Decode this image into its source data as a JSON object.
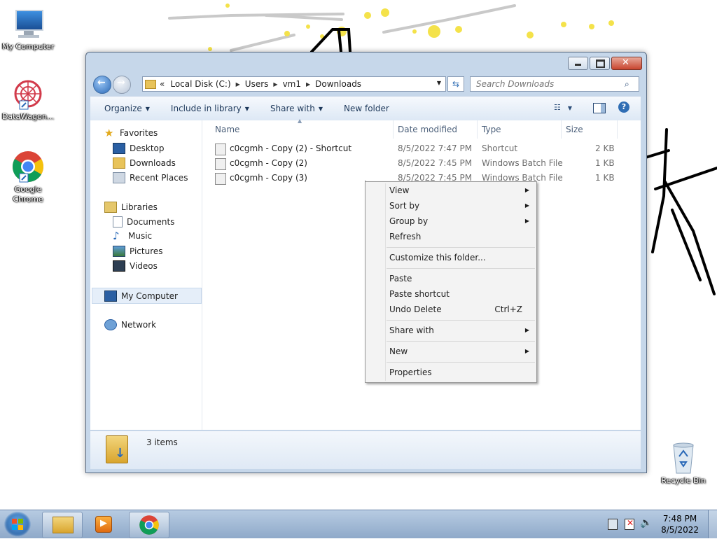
{
  "desktop": {
    "icons": [
      {
        "label": "My Computer"
      },
      {
        "label": "DataWagon..."
      },
      {
        "label": "Google Chrome"
      },
      {
        "label": "Recycle Bin"
      }
    ]
  },
  "window": {
    "address": {
      "overflow": "«",
      "crumbs": [
        "Local Disk (C:)",
        "Users",
        "vm1",
        "Downloads"
      ]
    },
    "search": {
      "placeholder": "Search Downloads"
    },
    "toolbar": {
      "organize": "Organize",
      "include": "Include in library",
      "share": "Share with",
      "new_folder": "New folder"
    },
    "nav": {
      "favorites": "Favorites",
      "desktop": "Desktop",
      "downloads": "Downloads",
      "recent": "Recent Places",
      "libraries": "Libraries",
      "documents": "Documents",
      "music": "Music",
      "pictures": "Pictures",
      "videos": "Videos",
      "computer": "My Computer",
      "network": "Network"
    },
    "columns": {
      "name": "Name",
      "date": "Date modified",
      "type": "Type",
      "size": "Size"
    },
    "files": [
      {
        "name": "c0cgmh - Copy (2) - Shortcut",
        "date": "8/5/2022 7:47 PM",
        "type": "Shortcut",
        "size": "2 KB"
      },
      {
        "name": "c0cgmh - Copy (2)",
        "date": "8/5/2022 7:45 PM",
        "type": "Windows Batch File",
        "size": "1 KB"
      },
      {
        "name": "c0cgmh - Copy (3)",
        "date": "8/5/2022 7:45 PM",
        "type": "Windows Batch File",
        "size": "1 KB"
      }
    ],
    "status": {
      "count": "3 items"
    }
  },
  "context_menu": {
    "view": "View",
    "sort_by": "Sort by",
    "group_by": "Group by",
    "refresh": "Refresh",
    "customize": "Customize this folder...",
    "paste": "Paste",
    "paste_shortcut": "Paste shortcut",
    "undo_delete": "Undo Delete",
    "undo_shortcut": "Ctrl+Z",
    "share_with": "Share with",
    "new": "New",
    "properties": "Properties"
  },
  "taskbar": {
    "time": "7:48 PM",
    "date": "8/5/2022"
  },
  "colors": {
    "accent": "#2a69b8",
    "window_frame": "#c6d7ea",
    "selection": "#dfe9f5"
  }
}
